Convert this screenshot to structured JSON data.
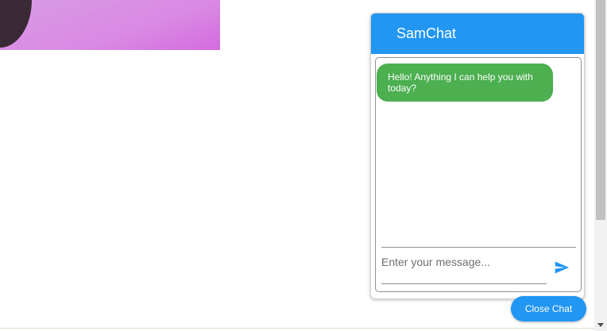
{
  "chat": {
    "title": "SamChat",
    "messages": [
      {
        "text": "Hello! Anything I can help you with today?",
        "sender": "bot"
      }
    ],
    "input": {
      "placeholder": "Enter your message...",
      "value": ""
    },
    "send_icon": "send-icon",
    "close_label": "Close Chat"
  },
  "colors": {
    "header": "#2196f3",
    "bot_bubble": "#4caf50",
    "close_button": "#2196f3",
    "send_icon": "#2196f3"
  }
}
